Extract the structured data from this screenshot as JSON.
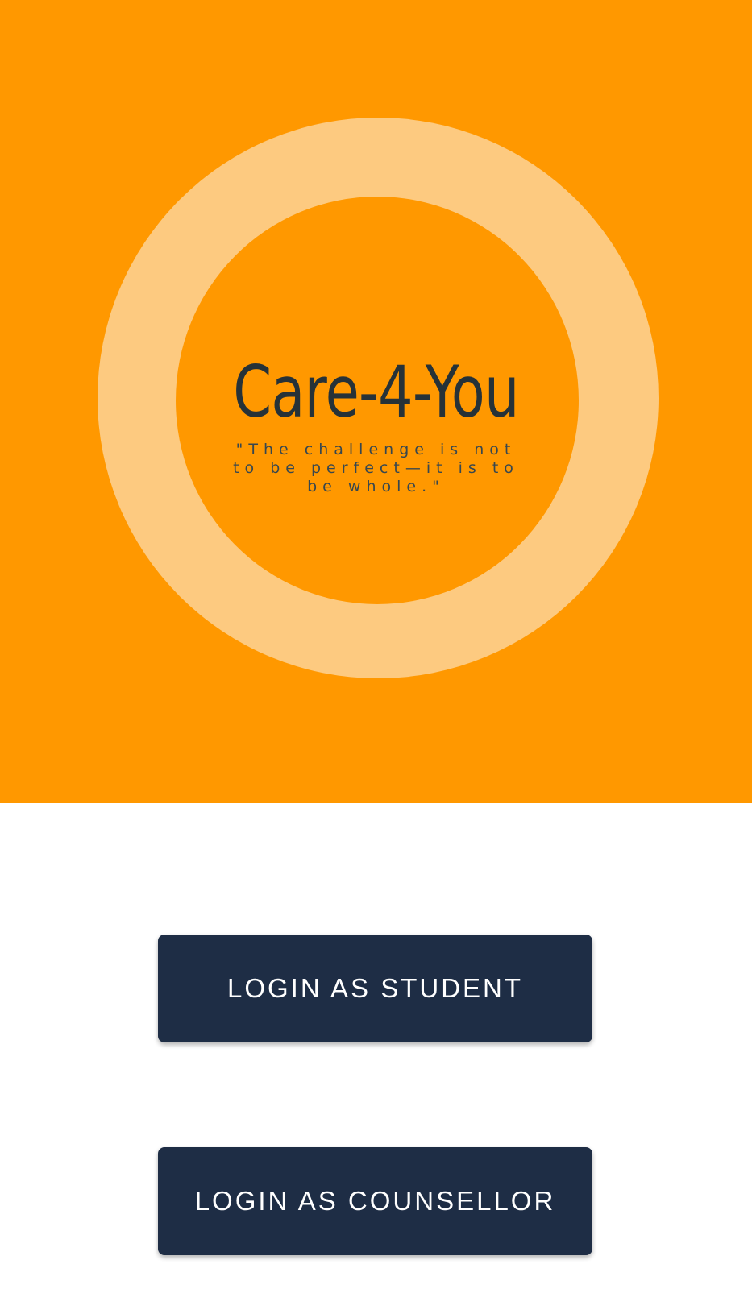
{
  "splash": {
    "app_name": "Care-4-You",
    "tagline": "\"The challenge is not to be perfect—it is to be whole.\"",
    "brand_color": "#FF9800",
    "ring_color": "#FDCA80"
  },
  "actions": {
    "student_login": "LOGIN AS STUDENT",
    "counsellor_login": "LOGIN AS COUNSELLOR",
    "button_color": "#1E2D45"
  }
}
